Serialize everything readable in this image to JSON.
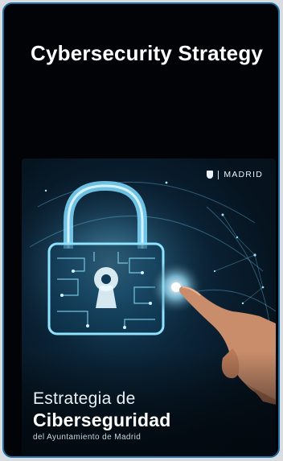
{
  "card": {
    "title": "Cybersecurity Strategy"
  },
  "cover": {
    "brand_name": "MADRID",
    "brand_icon": "madrid-shield-icon",
    "line1": "Estrategia de",
    "line2": "Ciberseguridad",
    "line3": "del Ayuntamiento de Madrid",
    "image_subject": "glowing-padlock-and-hand-icon"
  },
  "colors": {
    "card_background": "#010307",
    "card_border": "#1f6e9d",
    "glow": "#6fd3ff"
  }
}
